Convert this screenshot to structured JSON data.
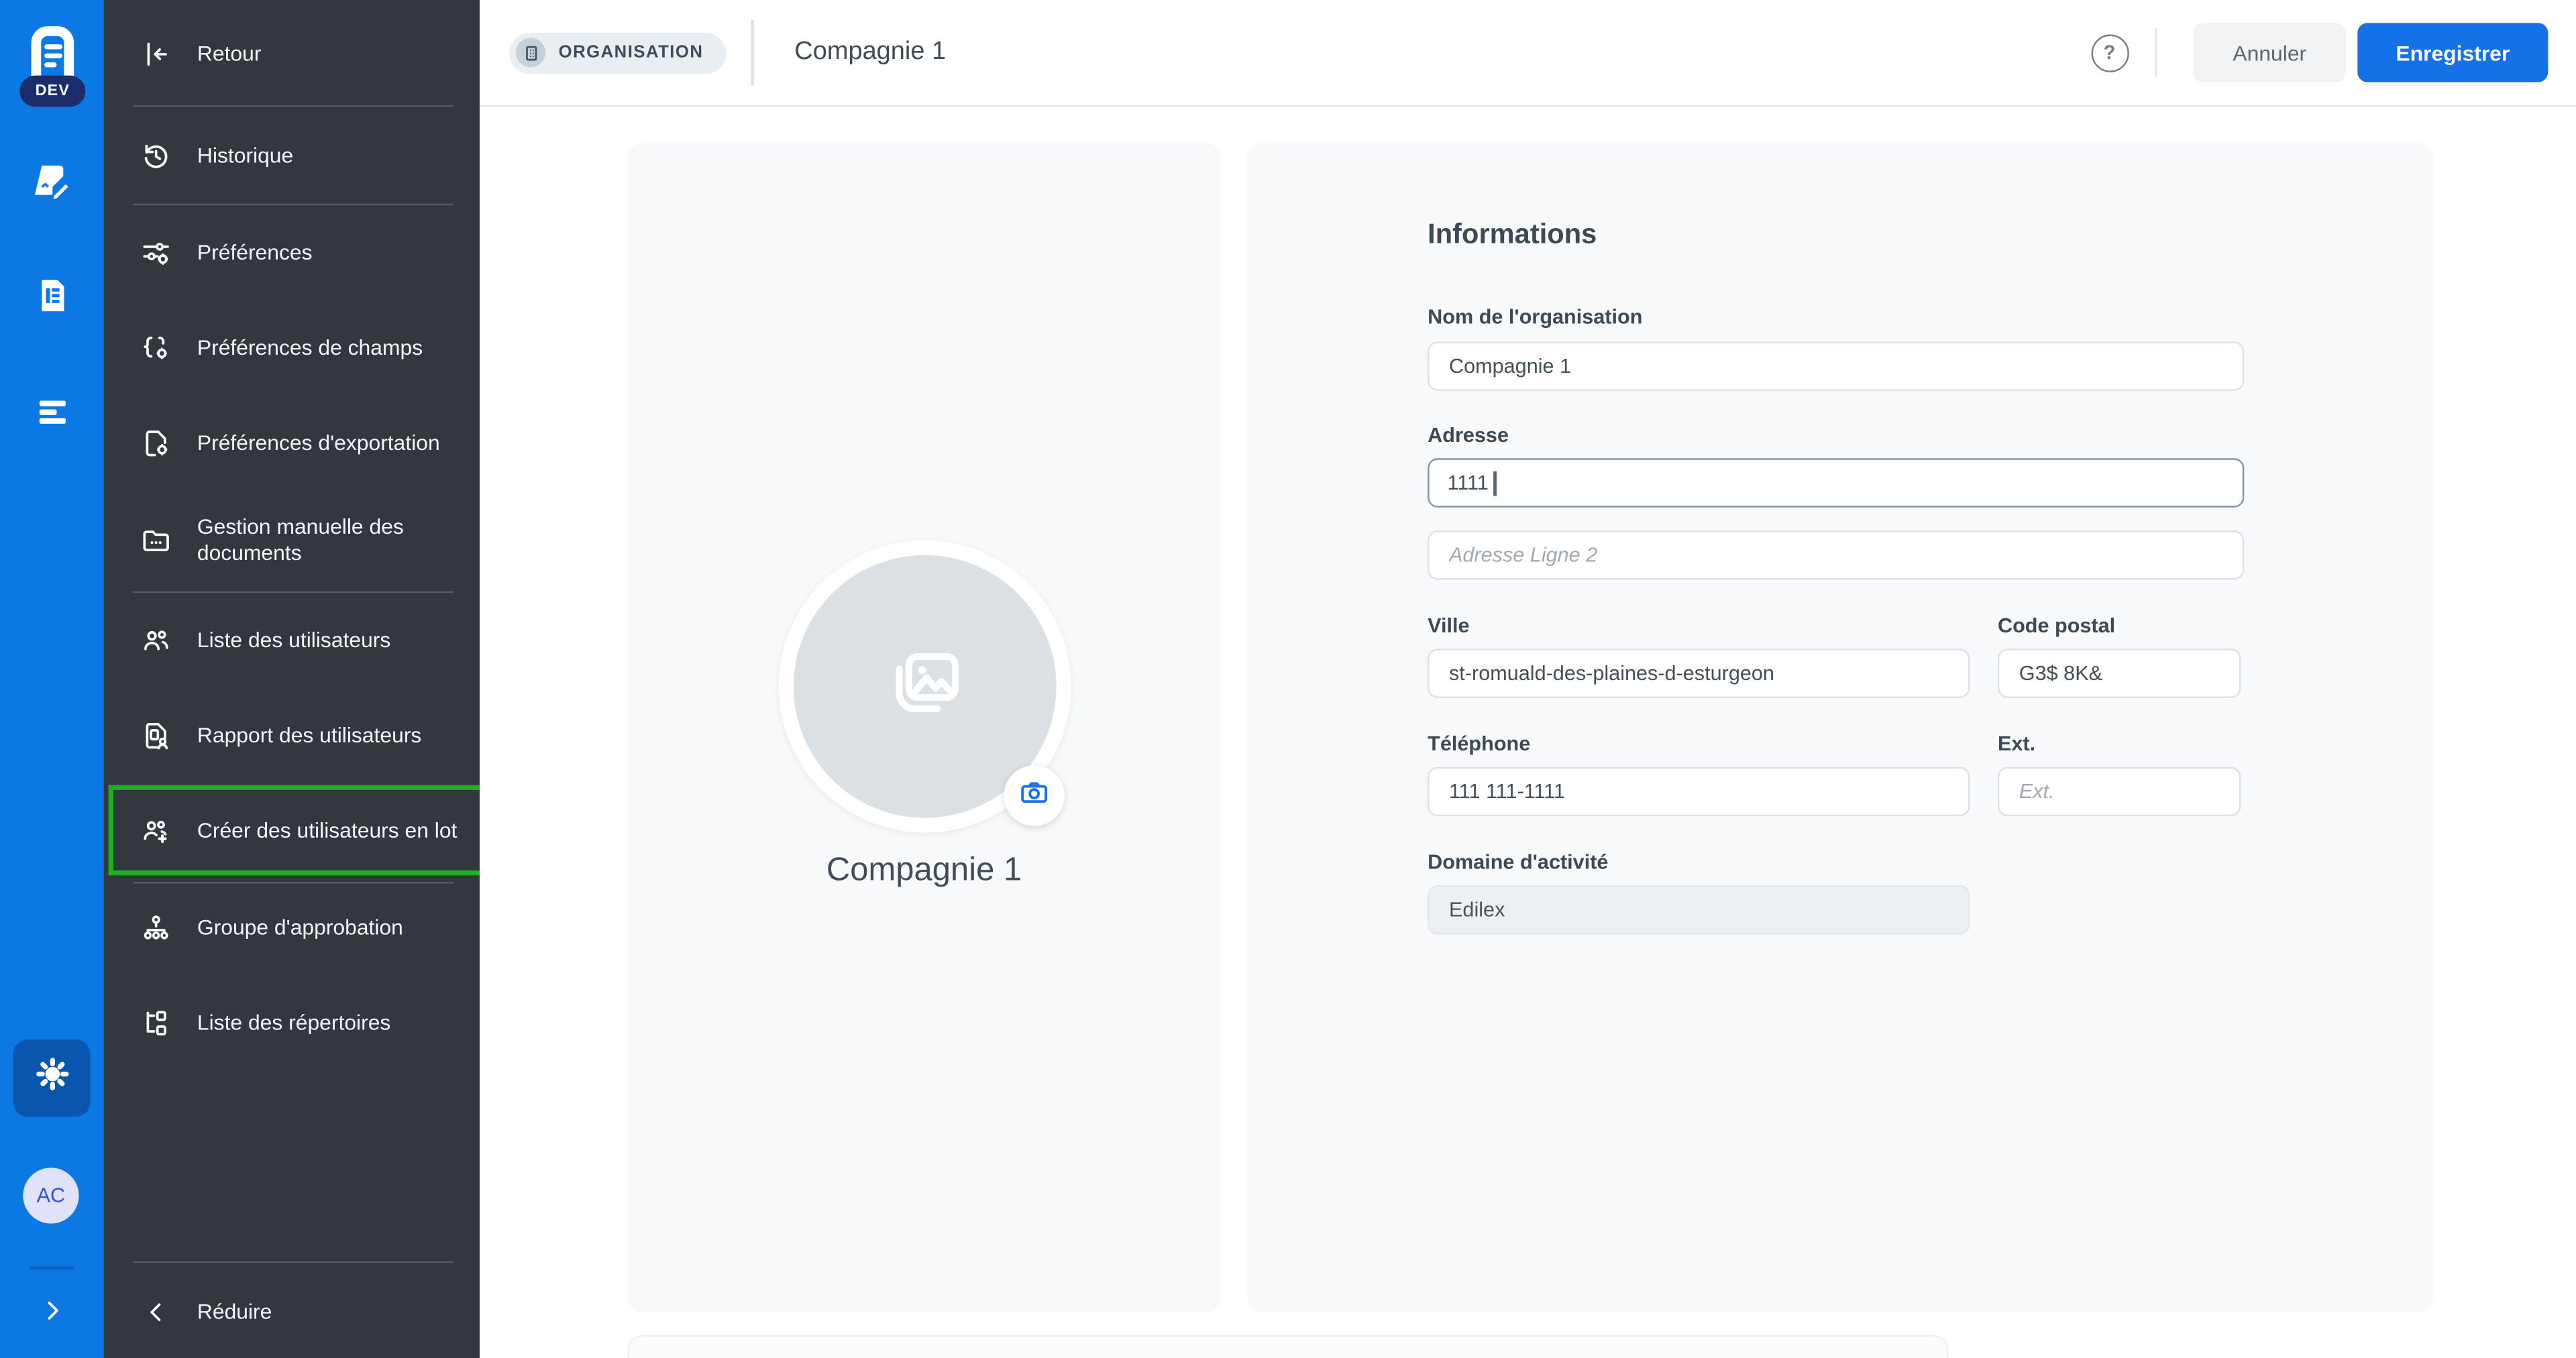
{
  "colors": {
    "rail_blue": "#0b78e3",
    "rail_tile": "#0a55ad",
    "dev_navy": "#1b2d6b",
    "sidebar_bg": "#33383e",
    "highlight_green": "#1cb021",
    "primary_blue": "#1571e8",
    "camera_blue": "#1672e8"
  },
  "rail": {
    "env_badge": "DEV",
    "avatar_initials": "AC"
  },
  "sidebar": {
    "back_label": "Retour",
    "items": [
      {
        "label": "Historique",
        "icon": "history-icon"
      },
      {
        "label": "Préférences",
        "icon": "sliders-gear-icon"
      },
      {
        "label": "Préférences de champs",
        "icon": "braces-gear-icon"
      },
      {
        "label": "Préférences d'exportation",
        "icon": "document-gear-icon"
      },
      {
        "label": "Gestion manuelle des documents",
        "icon": "folder-dots-icon"
      },
      {
        "label": "Liste des utilisateurs",
        "icon": "users-icon"
      },
      {
        "label": "Rapport des utilisateurs",
        "icon": "document-user-icon"
      },
      {
        "label": "Créer des utilisateurs en lot",
        "icon": "users-plus-icon",
        "highlighted": true
      },
      {
        "label": "Groupe d'approbation",
        "icon": "sitemap-icon"
      },
      {
        "label": "Liste des répertoires",
        "icon": "directory-tree-icon"
      }
    ],
    "collapse_label": "Réduire"
  },
  "topbar": {
    "context_badge": "ORGANISATION",
    "title": "Compagnie 1",
    "help_glyph": "?",
    "cancel_label": "Annuler",
    "save_label": "Enregistrer"
  },
  "profile_card": {
    "name": "Compagnie 1"
  },
  "form": {
    "heading": "Informations",
    "org_name": {
      "label": "Nom de l'organisation",
      "value": "Compagnie 1"
    },
    "address": {
      "label": "Adresse",
      "value": "1111",
      "state": "focused"
    },
    "address2": {
      "placeholder": "Adresse Ligne 2"
    },
    "city": {
      "label": "Ville",
      "value": "st-romuald-des-plaines-d-esturgeon"
    },
    "postal": {
      "label": "Code postal",
      "value": "G3$ 8K&"
    },
    "phone": {
      "label": "Téléphone",
      "value": "111 111-1111"
    },
    "ext": {
      "label": "Ext.",
      "placeholder": "Ext."
    },
    "domain": {
      "label": "Domaine d'activité",
      "value": "Edilex",
      "state": "disabled"
    }
  }
}
